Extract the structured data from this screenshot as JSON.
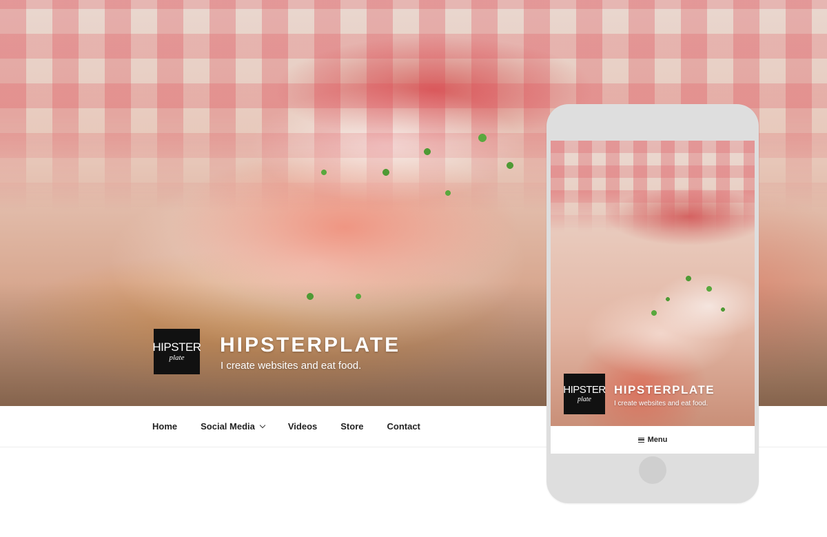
{
  "site": {
    "title": "HIPSTERPLATE",
    "description": "I create websites and eat food.",
    "logo": {
      "main": "HIPSTER",
      "sub": "plate"
    }
  },
  "nav": {
    "items": [
      {
        "label": "Home",
        "has_dropdown": false
      },
      {
        "label": "Social Media",
        "has_dropdown": true
      },
      {
        "label": "Videos",
        "has_dropdown": false
      },
      {
        "label": "Store",
        "has_dropdown": false
      },
      {
        "label": "Contact",
        "has_dropdown": false
      }
    ]
  },
  "mobile": {
    "site_title": "HIPSTERPLATE",
    "site_description": "I create websites and eat food.",
    "logo": {
      "main": "HIPSTER",
      "sub": "plate"
    },
    "menu_label": "Menu"
  },
  "icons": {
    "dropdown": "chevron-down-icon",
    "menu": "hamburger-icon"
  },
  "colors": {
    "page_background": "#ffffff",
    "text": "#222222",
    "phone_frame": "#dedede",
    "logo_background": "#111111"
  }
}
